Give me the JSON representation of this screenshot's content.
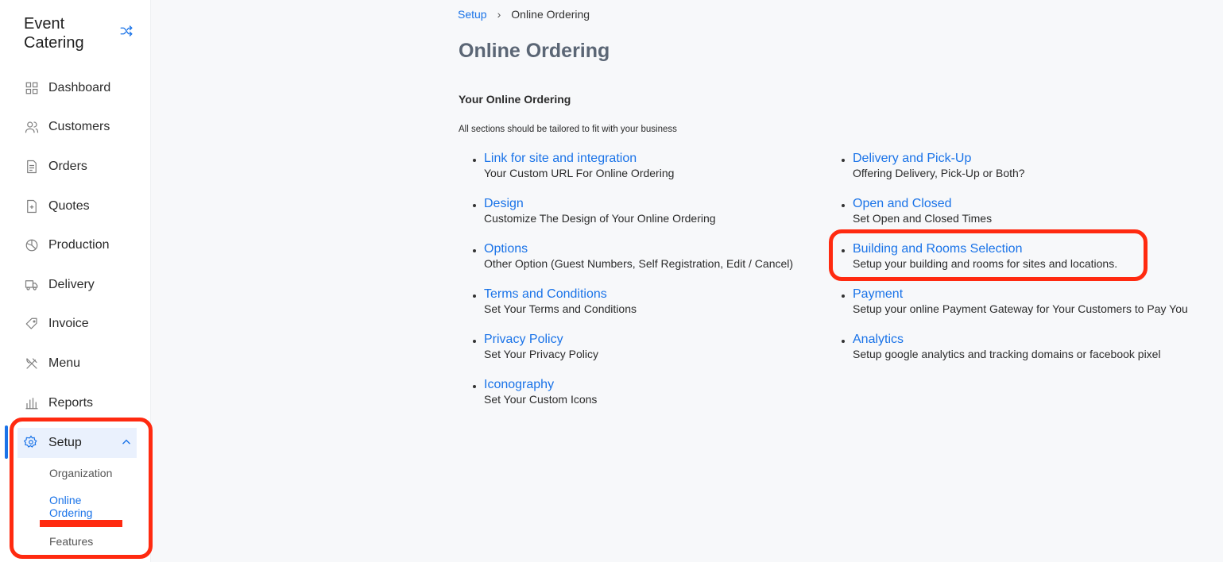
{
  "sidebar": {
    "brand": "Event Catering",
    "items": [
      {
        "label": "Dashboard",
        "icon": "dashboard-icon"
      },
      {
        "label": "Customers",
        "icon": "users-icon"
      },
      {
        "label": "Orders",
        "icon": "document-icon"
      },
      {
        "label": "Quotes",
        "icon": "quote-document-icon"
      },
      {
        "label": "Production",
        "icon": "pie-chart-icon"
      },
      {
        "label": "Delivery",
        "icon": "truck-icon"
      },
      {
        "label": "Invoice",
        "icon": "tag-icon"
      },
      {
        "label": "Menu",
        "icon": "utensils-icon"
      },
      {
        "label": "Reports",
        "icon": "bar-chart-icon"
      }
    ],
    "setup": {
      "label": "Setup",
      "icon": "gear-icon",
      "subitems": [
        "Organization",
        "Online Ordering",
        "Features"
      ],
      "active_subitem": "Online Ordering"
    }
  },
  "breadcrumb": {
    "parent": "Setup",
    "current": "Online Ordering"
  },
  "page": {
    "title": "Online Ordering",
    "section_title": "Your Online Ordering",
    "section_note": "All sections should be tailored to fit with your business"
  },
  "sections_left": [
    {
      "title": "Link for site and integration",
      "desc": "Your Custom URL For Online Ordering"
    },
    {
      "title": "Design",
      "desc": "Customize The Design of Your Online Ordering"
    },
    {
      "title": "Options",
      "desc": "Other Option (Guest Numbers, Self Registration, Edit / Cancel)"
    },
    {
      "title": "Terms and Conditions",
      "desc": "Set Your Terms and Conditions"
    },
    {
      "title": "Privacy Policy",
      "desc": "Set Your Privacy Policy"
    },
    {
      "title": "Iconography",
      "desc": "Set Your Custom Icons"
    }
  ],
  "sections_right": [
    {
      "title": "Delivery and Pick-Up",
      "desc": "Offering Delivery, Pick-Up or Both?"
    },
    {
      "title": "Open and Closed",
      "desc": "Set Open and Closed Times"
    },
    {
      "title": "Building and Rooms Selection",
      "desc": "Setup your building and rooms for sites and locations."
    },
    {
      "title": "Payment",
      "desc": "Setup your online Payment Gateway for Your Customers to Pay You"
    },
    {
      "title": "Analytics",
      "desc": "Setup google analytics and tracking domains or facebook pixel"
    }
  ],
  "colors": {
    "accent": "#1a73e8",
    "annotation": "#ff2a10"
  }
}
